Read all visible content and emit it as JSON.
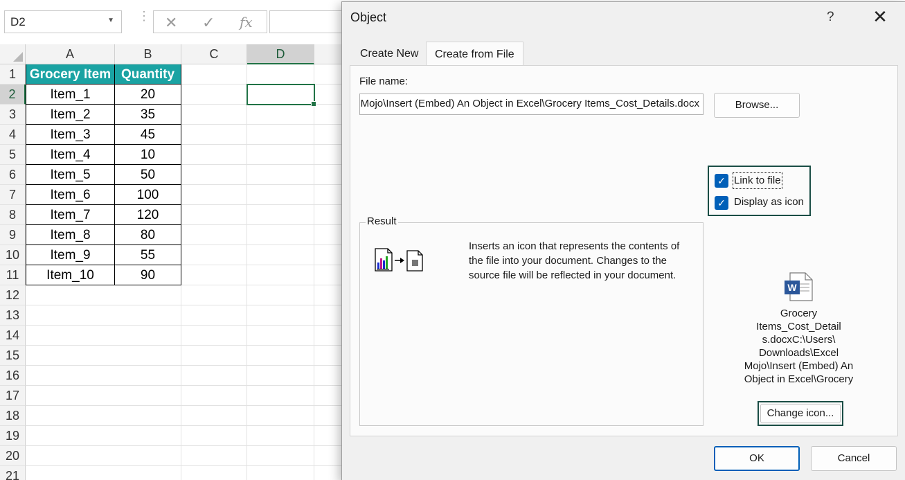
{
  "formula_bar": {
    "name_box": "D2",
    "cancel_glyph": "✕",
    "enter_glyph": "✓",
    "fx_glyph": "fx",
    "formula": ""
  },
  "sheet": {
    "columns": [
      "A",
      "B",
      "C",
      "D"
    ],
    "rows": [
      "1",
      "2",
      "3",
      "4",
      "5",
      "6",
      "7",
      "8",
      "9",
      "10",
      "11",
      "12",
      "13",
      "14",
      "15",
      "16",
      "17",
      "18",
      "19",
      "20",
      "21"
    ],
    "header_color": "#1aa3a3",
    "table": {
      "headers": [
        "Grocery Item",
        "Quantity"
      ],
      "rows": [
        [
          "Item_1",
          "20"
        ],
        [
          "Item_2",
          "35"
        ],
        [
          "Item_3",
          "45"
        ],
        [
          "Item_4",
          "10"
        ],
        [
          "Item_5",
          "50"
        ],
        [
          "Item_6",
          "100"
        ],
        [
          "Item_7",
          "120"
        ],
        [
          "Item_8",
          "80"
        ],
        [
          "Item_9",
          "55"
        ],
        [
          "Item_10",
          "90"
        ]
      ]
    }
  },
  "dialog": {
    "title": "Object",
    "help": "?",
    "close": "✕",
    "tabs": [
      {
        "label": "Create New",
        "active": false
      },
      {
        "label": "Create from File",
        "active": true
      }
    ],
    "file_name_label": "File name:",
    "file_name_value": "C:\\Users\\Downloads\\Excel Mojo\\Insert (Embed) An Object in Excel\\Grocery Items_Cost_Details.docx",
    "browse_label": "Browse...",
    "link_to_file_label": "Link to file",
    "link_to_file_checked": true,
    "display_as_icon_label": "Display as icon",
    "display_as_icon_checked": true,
    "result_label": "Result",
    "result_text": "Inserts an icon that represents the contents of the file into your document. Changes to the source file will be reflected in your document.",
    "icon_caption": "Grocery Items_Cost_Detail s.docxC:\\Users\\ Downloads\\Excel Mojo\\Insert (Embed) An Object in Excel\\Grocery",
    "change_icon_label": "Change icon...",
    "ok_label": "OK",
    "cancel_label": "Cancel"
  }
}
